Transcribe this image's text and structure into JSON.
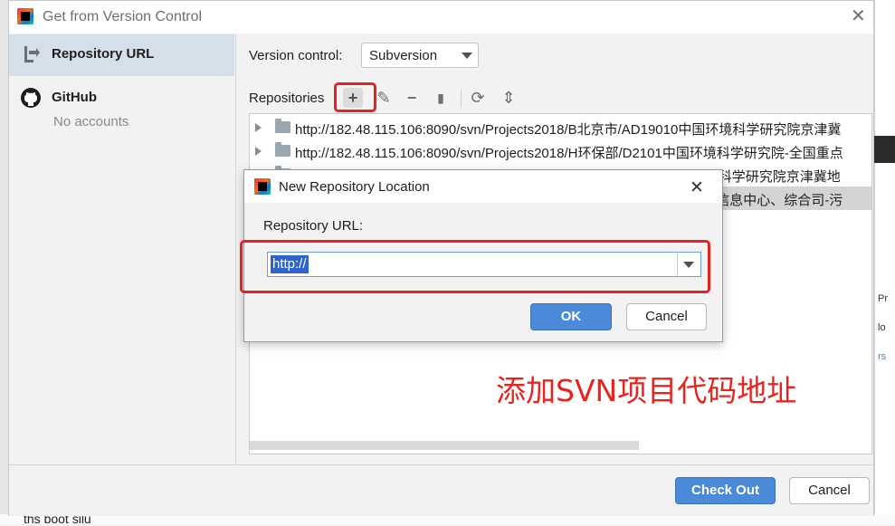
{
  "window": {
    "title": "Get from Version Control",
    "close_glyph": "✕"
  },
  "sidebar": {
    "items": [
      {
        "label": "Repository URL",
        "icon": "vcs-arrow-icon"
      },
      {
        "label": "GitHub",
        "sublabel": "No accounts",
        "icon": "github-icon"
      }
    ]
  },
  "main": {
    "version_control_label": "Version control:",
    "version_control_value": "Subversion",
    "repositories_label": "Repositories",
    "toolbar": {
      "add": "+",
      "edit": "✎",
      "remove": "−",
      "copy": "▮",
      "refresh": "⟳",
      "collapse": "⇕"
    },
    "repositories": [
      "http://182.48.115.106:8090/svn/Projects2018/B北京市/AD19010中国环境科学研究院京津冀",
      "http://182.48.115.106:8090/svn/Projects2018/H环保部/D2101中国环境科学研究院-全国重点",
      "http://192.168.0.12:8090/svn/Projects2018/B北京市/AD19010中国环境科学研究院京津冀地",
      "http://192.168.0.12:8090/svn/Projects2018/H环保部/D2101生态环境部信息中心、综合司-污"
    ]
  },
  "footer": {
    "checkout_label": "Check Out",
    "cancel_label": "Cancel"
  },
  "nested_dialog": {
    "title": "New Repository Location",
    "close_glyph": "✕",
    "field_label": "Repository URL:",
    "field_value": "http://",
    "ok_label": "OK",
    "cancel_label": "Cancel"
  },
  "annotation": {
    "text": "添加SVN项目代码地址",
    "color": "#e8241f"
  },
  "background": {
    "bottom_text": "ths boot silu",
    "right_texts": [
      "Pr",
      "lo",
      "rs"
    ]
  }
}
